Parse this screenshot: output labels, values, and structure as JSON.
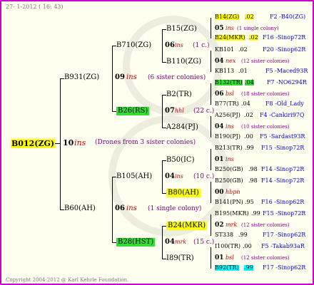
{
  "header": "27-  1-2012  ( 16: 43)",
  "footer": "Copyright 2004-2012 @ Karl Kehrle Foundation.",
  "root": {
    "id": "B012(ZG)",
    "year": "10",
    "ins": "ins",
    "note": "(Drones from 3 sister colonies)"
  },
  "g1": [
    {
      "id": "B931(ZG)",
      "year": "09",
      "ins": "ins",
      "note": "(6 sister colonies)"
    },
    {
      "id": "B60(AH)",
      "year": "06",
      "ins": "ins",
      "note": "(1 single colony)"
    }
  ],
  "g2": [
    {
      "id": "B710(ZG)",
      "year": "06",
      "ins": "ins",
      "note": "(1 c.)"
    },
    {
      "id": "B26(RS)",
      "year": "07",
      "ins": "hhl",
      "note": "(22 c.)"
    },
    {
      "id": "B105(AH)",
      "year": "04",
      "ins": "ins",
      "note": "(10 c.)"
    },
    {
      "id": "B28(HST)",
      "year": "04",
      "ins": "mrk",
      "note": "(15 c.)"
    }
  ],
  "g3": [
    {
      "id": "B15(ZG)",
      "year": "05",
      "ins": "ins",
      "note": "(1 single colony)"
    },
    {
      "id": "B110(ZG)",
      "year": "04",
      "ins": "nex",
      "note": "(12 sister colonies)"
    },
    {
      "id": "B2(TR)",
      "year": "06",
      "ins": "bsl",
      "note": "(18 sister colonies)"
    },
    {
      "id": "A284(PJ)",
      "year": "04",
      "ins": "ins",
      "note": "(10 sister colonies)"
    },
    {
      "id": "B50(IC)",
      "year": "01",
      "ins": "ins",
      "note": ""
    },
    {
      "id": "B80(AH)",
      "year": "00",
      "ins": "hbpn",
      "note": ""
    },
    {
      "id": "B24(MKR)",
      "year": "02",
      "ins": "mrk",
      "note": "(12 sister colonies)"
    },
    {
      "id": "I89(TR)",
      "year": "01",
      "ins": "bsl",
      "note": "(12 sister colonies)"
    }
  ],
  "g4": [
    {
      "id": "B14(ZG)",
      "val": ".02",
      "ref": "F2 -B40(ZG)"
    },
    {
      "id": "B24(MKR)",
      "val": ".02",
      "ref": "F16 -Sinop72R"
    },
    {
      "id": "KB101",
      "val": ".02",
      "ref": "F20 -Sinop62R"
    },
    {
      "id": "KB113",
      "val": ".01",
      "ref": "F5 -Maced93R"
    },
    {
      "id": "B132(TR)",
      "val": ".04",
      "ref": "F7 -NO6294R"
    },
    {
      "id": "B77(TR)",
      "val": ".04",
      "ref": "F8 -Old_Lady"
    },
    {
      "id": "A256(PJ)",
      "val": ".02",
      "ref": "F4 -Cankiri97Q"
    },
    {
      "id": "B190(PJ)",
      "val": ".00",
      "ref": "F5 -Sardast93R"
    },
    {
      "id": "B213(TR)",
      "val": ".99",
      "ref": "F15 -Sinop72R"
    },
    {
      "id": "B250(GB)",
      "val": ".98",
      "ref": "F14 -Sinop72R"
    },
    {
      "id": "B250(GB)",
      "val": ".98",
      "ref": "F14 -Sinop72R"
    },
    {
      "id": "B141(PN)",
      "val": ".95",
      "ref": "F16 -Sinop62R"
    },
    {
      "id": "B195(MKR)",
      "val": ".99",
      "ref": "F15 -Sinop72R"
    },
    {
      "id": "ST338",
      "val": ".99",
      "ref": "F17 -Sinop62R"
    },
    {
      "id": "I100(TR)",
      "val": ".00",
      "ref": "F5 -Takab93aR"
    },
    {
      "id": "B92(TR)",
      "val": ".99",
      "ref": "F17 -Sinop62R"
    }
  ]
}
